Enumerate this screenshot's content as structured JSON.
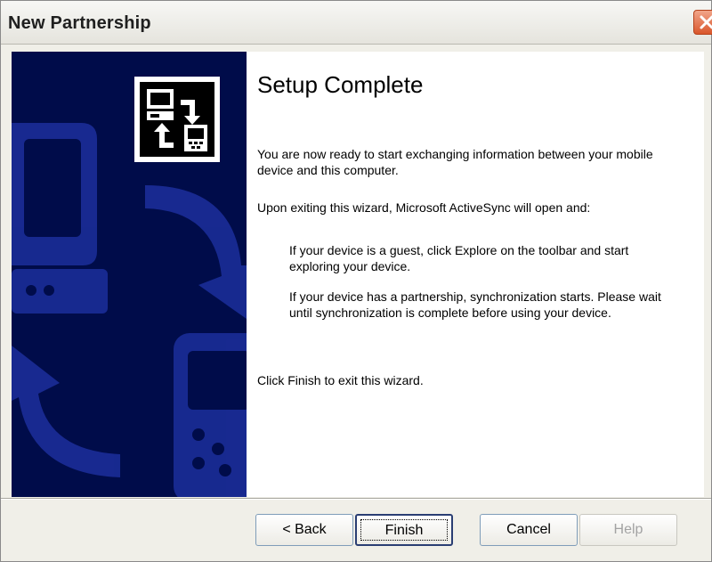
{
  "window": {
    "title": "New Partnership"
  },
  "content": {
    "heading": "Setup Complete",
    "paragraphs": [
      "You are now ready to start exchanging information between your mobile device and this computer.",
      "Upon exiting this wizard, Microsoft ActiveSync will open and:",
      "If your device is a guest, click Explore on the toolbar and start exploring your device.",
      "If your device has a partnership, synchronization starts. Please wait until synchronization is complete before using your device.",
      "Click Finish to exit this wizard."
    ]
  },
  "buttons": {
    "back": "< Back",
    "finish": "Finish",
    "cancel": "Cancel",
    "help": "Help"
  },
  "colors": {
    "side_panel": "#000c4a",
    "side_art": "#1c2f9c",
    "close_button": "#d9562b"
  },
  "icons": {
    "close": "close-icon",
    "wizard_logo": "activesync-logo-icon"
  }
}
